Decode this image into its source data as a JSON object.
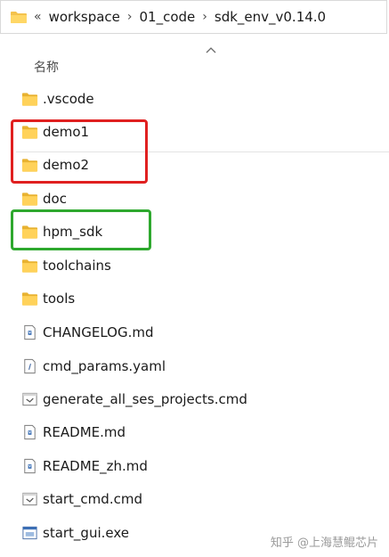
{
  "address_bar": {
    "overflow": "«",
    "crumbs": [
      "workspace",
      "01_code",
      "sdk_env_v0.14.0"
    ],
    "separator": "›"
  },
  "column_header": {
    "name": "名称"
  },
  "files": [
    {
      "label": ".vscode",
      "icon": "folder-icon"
    },
    {
      "label": "demo1",
      "icon": "folder-icon"
    },
    {
      "label": "demo2",
      "icon": "folder-icon"
    },
    {
      "label": "doc",
      "icon": "folder-icon"
    },
    {
      "label": "hpm_sdk",
      "icon": "folder-icon"
    },
    {
      "label": "toolchains",
      "icon": "folder-icon"
    },
    {
      "label": "tools",
      "icon": "folder-icon"
    },
    {
      "label": "CHANGELOG.md",
      "icon": "markdown-file-icon"
    },
    {
      "label": "cmd_params.yaml",
      "icon": "yaml-file-icon"
    },
    {
      "label": "generate_all_ses_projects.cmd",
      "icon": "cmd-file-icon"
    },
    {
      "label": "README.md",
      "icon": "markdown-file-icon"
    },
    {
      "label": "README_zh.md",
      "icon": "markdown-file-icon"
    },
    {
      "label": "start_cmd.cmd",
      "icon": "cmd-file-icon"
    },
    {
      "label": "start_gui.exe",
      "icon": "exe-file-icon"
    }
  ],
  "annotations": {
    "red_box_color": "#e02020",
    "green_box_color": "#2ea82e"
  },
  "watermark": "知乎 @上海慧鲲芯片"
}
